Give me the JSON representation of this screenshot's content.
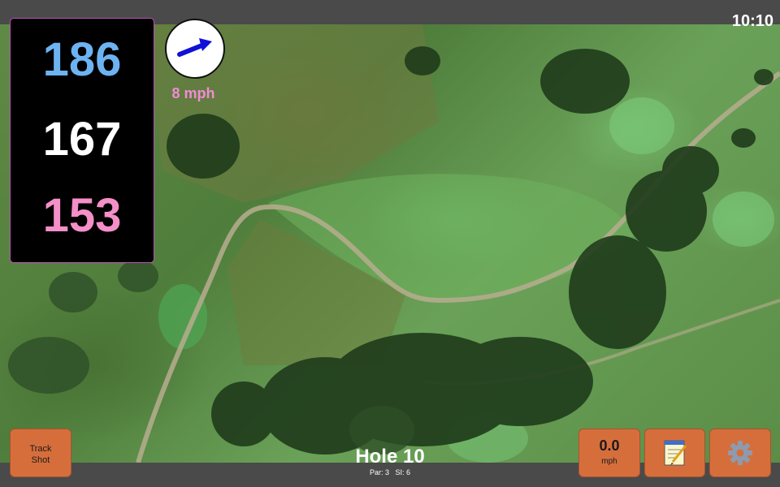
{
  "status_bar": {
    "time": "10:10"
  },
  "distances": {
    "back": "186",
    "middle": "167",
    "front": "153"
  },
  "wind": {
    "speed_label": "8 mph",
    "icon": "wind-arrow-icon"
  },
  "track_shot": {
    "line1": "Track",
    "line2": "Shot"
  },
  "hole": {
    "title": "Hole 10",
    "par_label": "Par: 3",
    "si_label": "SI: 6"
  },
  "speed": {
    "value": "0.0",
    "unit": "mph"
  },
  "toolbar": {
    "notes_icon": "notepad-icon",
    "settings_icon": "gear-icon"
  },
  "colors": {
    "back_distance": "#6db3f2",
    "middle_distance": "#ffffff",
    "front_distance": "#f48fc8",
    "wind_label": "#f28bd6",
    "button": "#d66e3c",
    "panel_border": "#c24bc2"
  }
}
